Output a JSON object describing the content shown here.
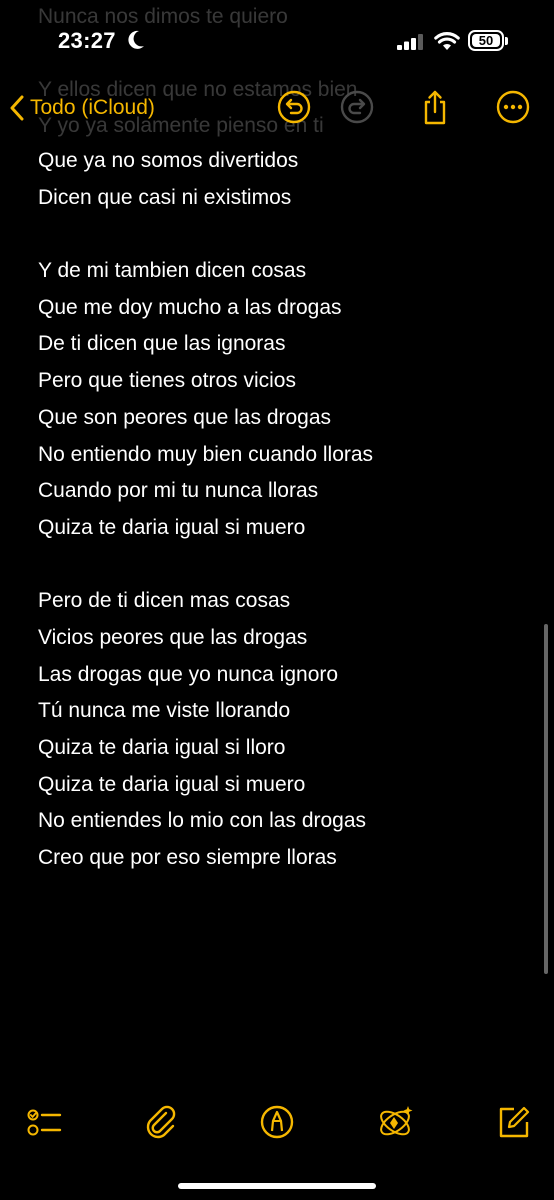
{
  "status": {
    "time": "23:27",
    "battery": "50"
  },
  "nav": {
    "back_label": "Todo (iCloud)"
  },
  "note": {
    "scrolled_lines": [
      "Nunca nos dimos te quiero",
      "Y ellos dicen que no estamos bien",
      "Y yo ya solamente pienso en ti"
    ],
    "lines": [
      "Que ya no somos divertidos",
      "Dicen que casi ni existimos",
      "",
      "Y de mi tambien dicen cosas",
      "Que me doy mucho a las drogas",
      "De ti dicen que las ignoras",
      "Pero que tienes otros vicios",
      "Que son peores que las drogas",
      "No entiendo muy bien cuando lloras",
      "Cuando por mi tu nunca lloras",
      "Quiza te daria igual si muero",
      "",
      "Pero de ti dicen mas cosas",
      "Vicios peores que las drogas",
      "Las drogas que yo nunca ignoro",
      "Tú nunca me viste llorando",
      "Quiza te daria igual si lloro",
      "Quiza te daria igual si muero",
      "No entiendes lo mio con las drogas",
      "Creo que por eso siempre lloras"
    ]
  },
  "colors": {
    "accent": "#f5b700",
    "background": "#000000",
    "text": "#ffffff"
  },
  "icons": {
    "nav": [
      "chevron-left-icon",
      "undo-icon",
      "redo-icon",
      "share-icon",
      "more-icon"
    ],
    "toolbar": [
      "checklist-icon",
      "paperclip-icon",
      "markup-icon",
      "writing-tools-icon",
      "compose-icon"
    ]
  }
}
